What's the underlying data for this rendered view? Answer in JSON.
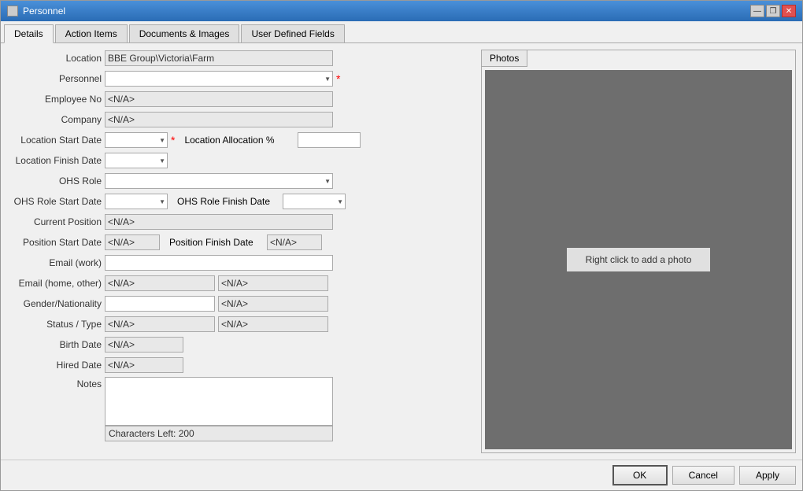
{
  "window": {
    "title": "Personnel",
    "icon_label": "personnel-icon"
  },
  "title_buttons": {
    "minimize": "—",
    "restore": "❐",
    "close": "✕"
  },
  "tabs": [
    {
      "label": "Details",
      "active": true
    },
    {
      "label": "Action Items",
      "active": false
    },
    {
      "label": "Documents & Images",
      "active": false
    },
    {
      "label": "User Defined Fields",
      "active": false
    }
  ],
  "photos": {
    "tab_label": "Photos",
    "placeholder": "Right click to add a photo"
  },
  "form": {
    "location_label": "Location",
    "location_value": "BBE Group\\Victoria\\Farm",
    "personnel_label": "Personnel",
    "personnel_value": "",
    "employee_no_label": "Employee No",
    "employee_no_value": "<N/A>",
    "company_label": "Company",
    "company_value": "<N/A>",
    "location_start_date_label": "Location Start Date",
    "location_start_date_value": "",
    "location_allocation_label": "Location Allocation %",
    "location_allocation_value": "",
    "location_finish_date_label": "Location Finish Date",
    "location_finish_date_value": "",
    "ohs_role_label": "OHS Role",
    "ohs_role_value": "",
    "ohs_role_start_date_label": "OHS Role Start Date",
    "ohs_role_start_date_value": "",
    "ohs_role_finish_date_label": "OHS Role Finish Date",
    "ohs_role_finish_date_value": "",
    "current_position_label": "Current Position",
    "current_position_value": "<N/A>",
    "position_start_date_label": "Position Start Date",
    "position_start_date_value": "<N/A>",
    "position_finish_date_label": "Position Finish Date",
    "position_finish_date_value": "<N/A>",
    "email_work_label": "Email (work)",
    "email_work_value": "",
    "email_home_label": "Email (home, other)",
    "email_home_value1": "<N/A>",
    "email_home_value2": "<N/A>",
    "gender_nationality_label": "Gender/Nationality",
    "gender_nationality_value1": "",
    "gender_nationality_value2": "<N/A>",
    "status_type_label": "Status / Type",
    "status_type_value1": "<N/A>",
    "status_type_value2": "<N/A>",
    "birth_date_label": "Birth Date",
    "birth_date_value": "<N/A>",
    "hired_date_label": "Hired Date",
    "hired_date_value": "<N/A>",
    "notes_label": "Notes",
    "notes_value": "",
    "char_count": "Characters Left: 200"
  },
  "buttons": {
    "ok": "OK",
    "cancel": "Cancel",
    "apply": "Apply"
  }
}
